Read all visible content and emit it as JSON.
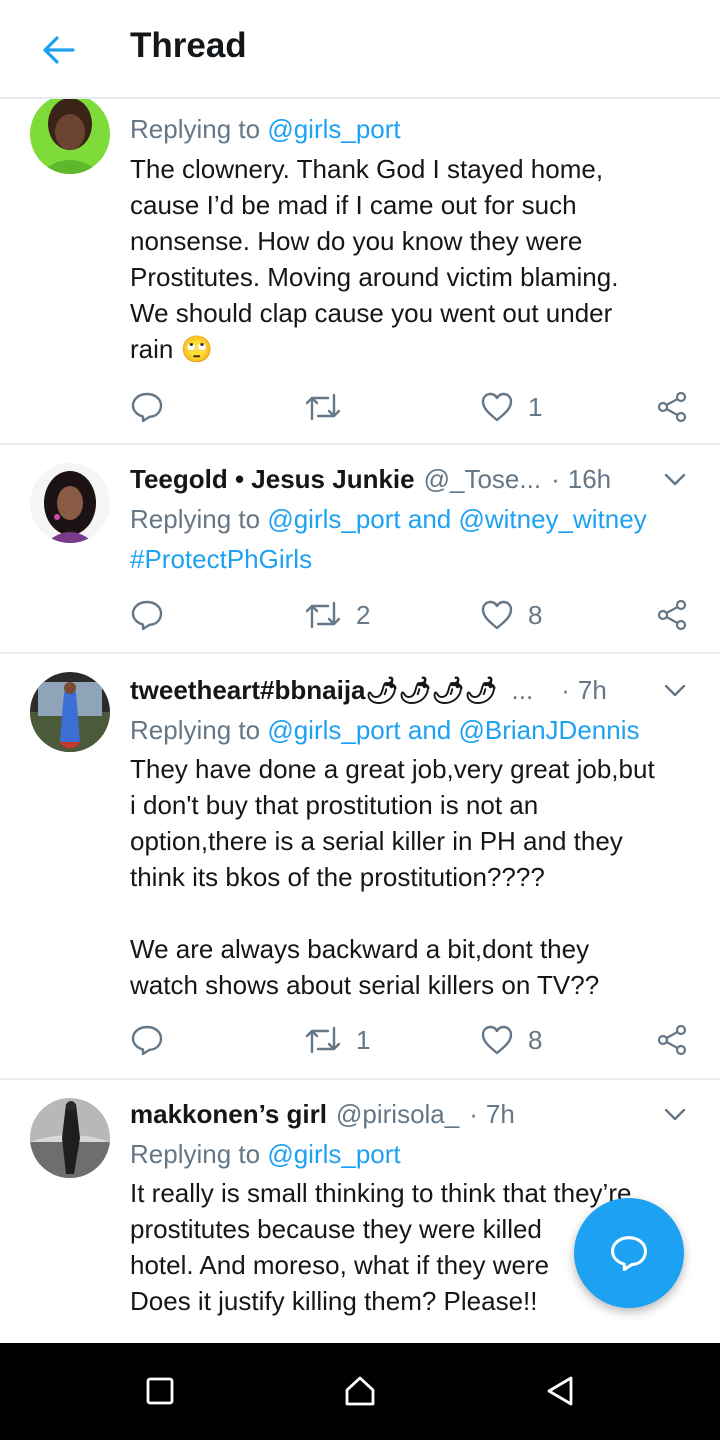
{
  "header": {
    "title": "Thread"
  },
  "colors": {
    "accent": "#1da1f2",
    "text": "#14171a",
    "secondary": "#657786",
    "divider": "#e6ecf0"
  },
  "tweets": [
    {
      "reply_prefix": "Replying to ",
      "reply_to": "@girls_port",
      "text": "The clownery. Thank God I stayed home,\ncause I’d be mad if I came out for such\nnonsense. How do you know they were\nProstitutes. Moving around victim blaming.\nWe should clap cause you went out under\nrain 🙄",
      "retweets": "",
      "likes": "1"
    },
    {
      "name": "Teegold • Jesus Junkie",
      "handle": "@_Tose...",
      "dot": "·",
      "time": "16h",
      "reply_prefix": "Replying to ",
      "reply_to": "@girls_port and @witney_witney",
      "hashtag": "#ProtectPhGirls",
      "retweets": "2",
      "likes": "8"
    },
    {
      "name": "tweetheart#bbnaija🌶🌶🌶🌶",
      "ellipsis": "...",
      "dot": "·",
      "time": "7h",
      "reply_prefix": "Replying to ",
      "reply_to": "@girls_port and @BrianJDennis",
      "text": "They have done a great job,very great job,but\ni don't buy that prostitution is not an\noption,there is a serial killer in PH and they\nthink its bkos of the prostitution????\n\nWe are always backward a bit,dont they\nwatch shows about serial killers on TV??",
      "retweets": "1",
      "likes": "8"
    },
    {
      "name": "makkonen’s girl",
      "handle": "@pirisola_",
      "dot": "·",
      "time": "7h",
      "reply_prefix": "Replying to ",
      "reply_to": "@girls_port",
      "text": "It really is small thinking to think that they’re\nprostitutes because they were killed\nhotel. And moreso, what if they were\nDoes it justify killing them? Please!!"
    }
  ]
}
